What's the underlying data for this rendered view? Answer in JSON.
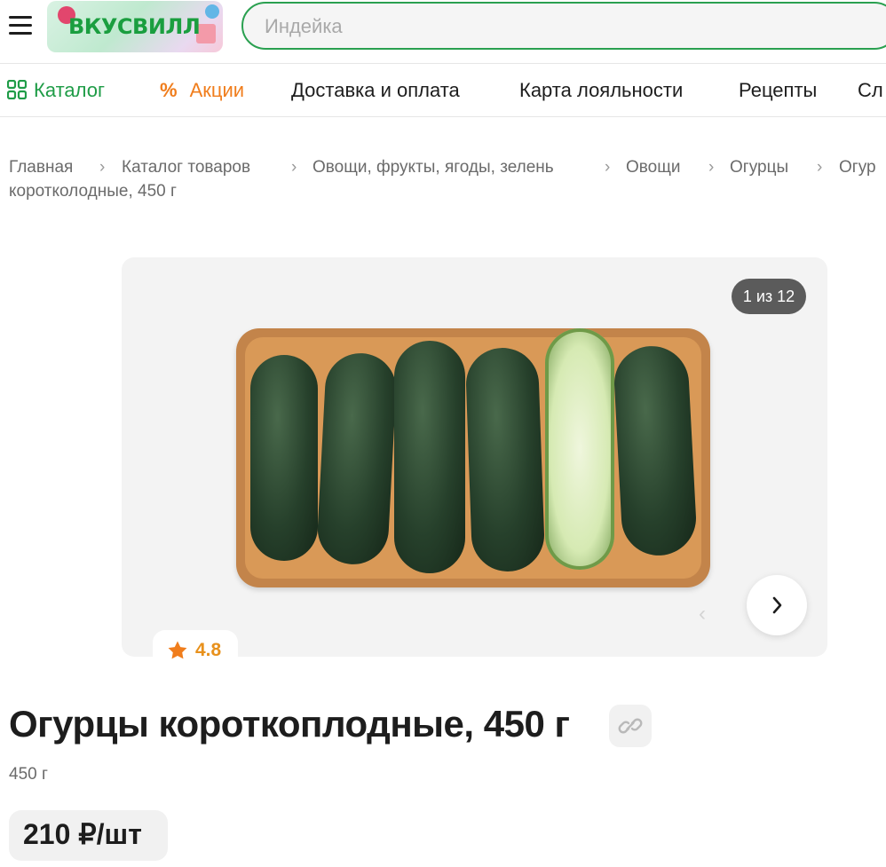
{
  "header": {
    "logo_text": "ВКУСВИЛЛ",
    "search_placeholder": "Индейка",
    "brand_color": "#2aa050"
  },
  "nav": {
    "items": [
      {
        "label": "Каталог",
        "icon": "grid-icon",
        "color": "#1f9c47"
      },
      {
        "label": "Акции",
        "icon": "percent-icon",
        "color": "#f07d1c"
      },
      {
        "label": "Доставка и оплата"
      },
      {
        "label": "Карта лояльности"
      },
      {
        "label": "Рецепты"
      },
      {
        "label": "Сл"
      }
    ]
  },
  "breadcrumbs": {
    "items": [
      "Главная",
      "Каталог товаров",
      "Овощи, фрукты, ягоды, зелень",
      "Овощи",
      "Огурцы",
      "Огур"
    ],
    "continuation": "коротколодные, 450 г"
  },
  "gallery": {
    "counter": "1 из 12",
    "rating": "4.8"
  },
  "product": {
    "title": "Огурцы короткоплодные, 450 г",
    "weight": "450 г",
    "price": "210 ₽/шт"
  }
}
